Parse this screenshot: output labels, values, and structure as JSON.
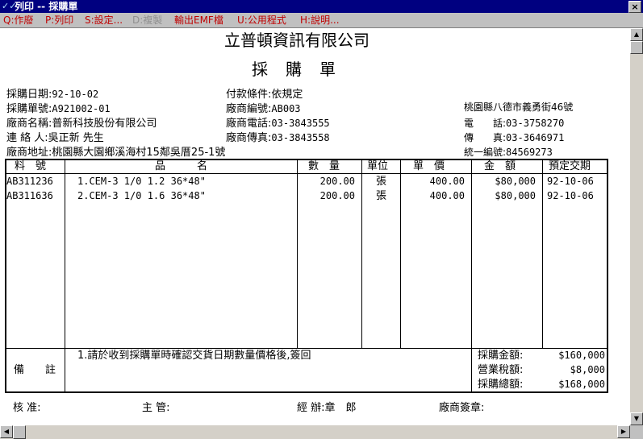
{
  "window": {
    "title": "列印 -- 採購單",
    "close_label": "×"
  },
  "menu": [
    "Q:作廢",
    "P:列印",
    "S:設定...",
    "D:複製",
    "輸出EMF檔",
    "U:公用程式",
    "H:說明..."
  ],
  "doc": {
    "company": "立普頓資訊有限公司",
    "title": "採購單",
    "info_left": [
      {
        "label": "採購日期:",
        "value": "92-10-02"
      },
      {
        "label": "採購單號:",
        "value": "A921002-01"
      },
      {
        "label": "廠商名稱:",
        "value": "普新科技股份有限公司"
      },
      {
        "label": "連 絡 人:",
        "value": "吳正新 先生"
      },
      {
        "label": "廠商地址:",
        "value": "桃園縣大園鄉溪海村15鄰吳厝25-1號"
      }
    ],
    "info_mid": [
      {
        "label": "付款條件:",
        "value": "依規定"
      },
      {
        "label": "廠商編號:",
        "value": "AB003"
      },
      {
        "label": "廠商電話:",
        "value": "03-3843555"
      },
      {
        "label": "廠商傳真:",
        "value": "03-3843558"
      }
    ],
    "info_right": {
      "address": "桃園縣八德市義勇街46號",
      "phone_label": "電　　話:",
      "phone": "03-3758270",
      "fax_label": "傳　　真:",
      "fax": "03-3646971",
      "tax_label": "統一編號:",
      "tax": "84569273"
    },
    "columns": [
      "料　號",
      "品　　　名",
      "數　量",
      "單位",
      "單　價",
      "金　額",
      "預定交期"
    ],
    "rows": [
      {
        "code": "AB311236",
        "name": "1.CEM-3 1/0 1.2 36*48\"",
        "qty": "200.00",
        "unit": "張",
        "price": "400.00",
        "amount": "$80,000",
        "date": "92-10-06"
      },
      {
        "code": "AB311636",
        "name": "2.CEM-3 1/0 1.6 36*48\"",
        "qty": "200.00",
        "unit": "張",
        "price": "400.00",
        "amount": "$80,000",
        "date": "92-10-06"
      }
    ],
    "remarks_label": "備　　註",
    "remarks": "1.請於收到採購單時確認交貨日期數量價格後,簽回",
    "totals": [
      {
        "label": "採購金額:",
        "value": "$160,000"
      },
      {
        "label": "營業稅額:",
        "value": "$8,000"
      },
      {
        "label": "採購總額:",
        "value": "$168,000"
      }
    ],
    "signatures": {
      "approve": "核 准:",
      "manager": "主 管:",
      "handler": "經 辦:章　郎",
      "vendor": "廠商簽章:"
    }
  }
}
